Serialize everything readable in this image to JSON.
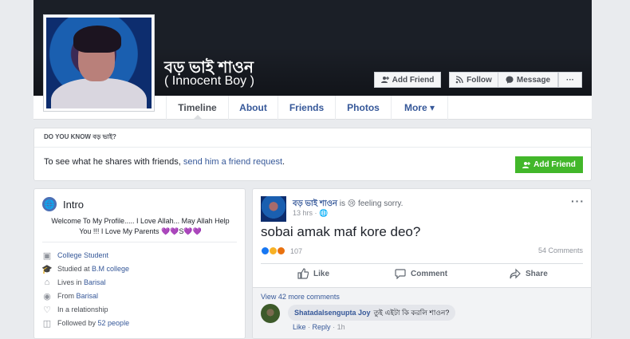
{
  "profile": {
    "name": "বড় ভাই শাওন",
    "subtitle": "( Innocent Boy )"
  },
  "header_buttons": {
    "add_friend": "Add Friend",
    "follow": "Follow",
    "message": "Message",
    "more": "···"
  },
  "tabs": [
    "Timeline",
    "About",
    "Friends",
    "Photos",
    "More ▾"
  ],
  "dyk": {
    "heading": "DO YOU KNOW বড় ভাই?",
    "text_before": "To see what he shares with friends, ",
    "link": "send him a friend request",
    "text_after": ".",
    "button": "Add Friend"
  },
  "intro": {
    "title": "Intro",
    "bio": "Welcome To My Profile..... I Love Allah... May Allah Help You !!! I Love My Parents 💜💜S💜💜",
    "rows": [
      {
        "prefix": "",
        "link": "College Student",
        "icon": "briefcase-icon"
      },
      {
        "prefix": "Studied at ",
        "link": "B.M college",
        "icon": "graduation-cap-icon"
      },
      {
        "prefix": "Lives in ",
        "link": "Barisal",
        "icon": "home-icon"
      },
      {
        "prefix": "From ",
        "link": "Barisal",
        "icon": "location-pin-icon"
      },
      {
        "prefix": "In a relationship",
        "link": "",
        "icon": "heart-icon"
      },
      {
        "prefix": "Followed by ",
        "link": "52 people",
        "icon": "rss-icon"
      }
    ]
  },
  "post": {
    "author": "বড় ভাই শাওন",
    "feeling": " is 😢 feeling sorry.",
    "time": "13 hrs · 🌐",
    "menu": "···",
    "text": "sobai amak maf kore deo?",
    "reaction_count": "107",
    "comments_count": "54 Comments",
    "actions": {
      "like": "Like",
      "comment": "Comment",
      "share": "Share"
    },
    "view_more": "View 42 more comments",
    "comment": {
      "author": "Shatadalsengupta Joy",
      "text": "তুই এইটা কি করলি শাওন?",
      "like": "Like",
      "reply": "Reply",
      "time": "1h"
    }
  },
  "colors": {
    "cover": "#1b1f27",
    "link": "#365899",
    "green": "#42b72a",
    "page_bg": "#e9ebee"
  }
}
